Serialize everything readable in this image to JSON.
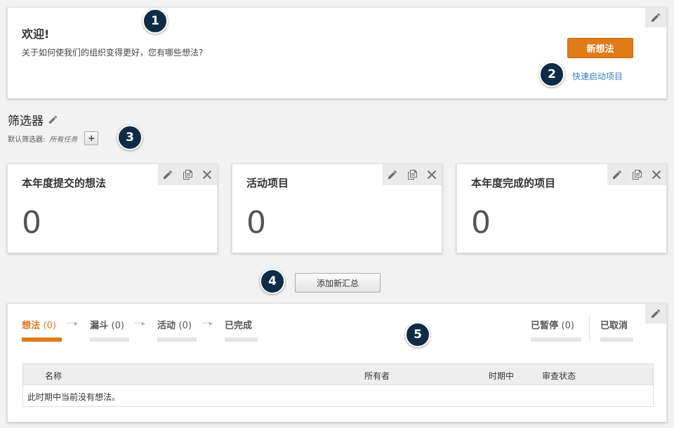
{
  "welcome": {
    "title": "欢迎!",
    "subtitle": "关于如何使我们的组织变得更好，您有哪些想法?",
    "new_idea_label": "新想法",
    "quick_start_label": "快速启动项目"
  },
  "filter": {
    "title": "筛选器",
    "default_label": "默认筛选器:",
    "default_value": "所有任务",
    "add_label": "+"
  },
  "cards": [
    {
      "title": "本年度提交的想法",
      "value": "0"
    },
    {
      "title": "活动项目",
      "value": "0"
    },
    {
      "title": "本年度完成的项目",
      "value": "0"
    }
  ],
  "add_summary_label": "添加新汇总",
  "pipeline": {
    "stages": [
      {
        "label": "想法",
        "count": "(0)"
      },
      {
        "label": "漏斗",
        "count": "(0)"
      },
      {
        "label": "活动",
        "count": "(0)"
      },
      {
        "label": "已完成",
        "count": ""
      }
    ],
    "paused": {
      "label": "已暂停",
      "count": "(0)"
    },
    "cancelled": {
      "label": "已取消",
      "count": ""
    },
    "arrow": "·····▸",
    "table": {
      "columns": [
        "名称",
        "所有者",
        "时期中",
        "审查状态"
      ],
      "empty_message": "此时期中当前没有想法。"
    }
  },
  "badges": [
    "1",
    "2",
    "3",
    "4",
    "5"
  ],
  "colors": {
    "accent": "#e07b17",
    "link": "#3a7ec1",
    "badge": "#0f2b46"
  }
}
